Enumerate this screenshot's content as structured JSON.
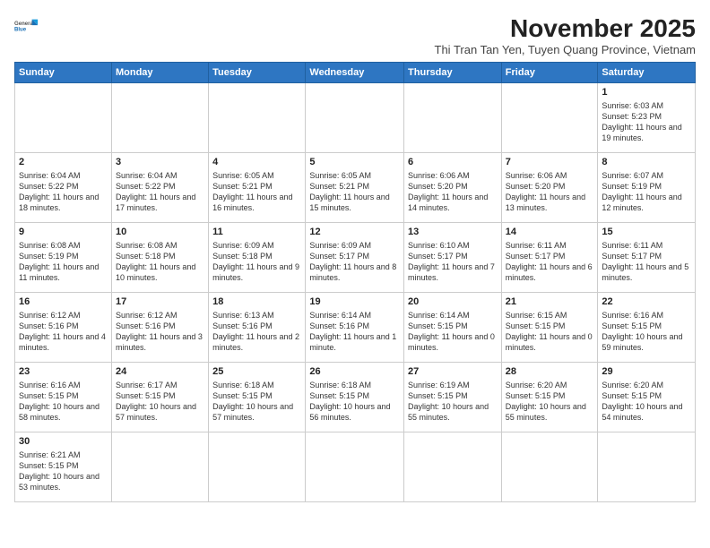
{
  "logo": {
    "line1": "General",
    "line2": "Blue"
  },
  "title": "November 2025",
  "subtitle": "Thi Tran Tan Yen, Tuyen Quang Province, Vietnam",
  "weekdays": [
    "Sunday",
    "Monday",
    "Tuesday",
    "Wednesday",
    "Thursday",
    "Friday",
    "Saturday"
  ],
  "weeks": [
    [
      {
        "day": "",
        "info": ""
      },
      {
        "day": "",
        "info": ""
      },
      {
        "day": "",
        "info": ""
      },
      {
        "day": "",
        "info": ""
      },
      {
        "day": "",
        "info": ""
      },
      {
        "day": "",
        "info": ""
      },
      {
        "day": "1",
        "info": "Sunrise: 6:03 AM\nSunset: 5:23 PM\nDaylight: 11 hours and 19 minutes."
      }
    ],
    [
      {
        "day": "2",
        "info": "Sunrise: 6:04 AM\nSunset: 5:22 PM\nDaylight: 11 hours and 18 minutes."
      },
      {
        "day": "3",
        "info": "Sunrise: 6:04 AM\nSunset: 5:22 PM\nDaylight: 11 hours and 17 minutes."
      },
      {
        "day": "4",
        "info": "Sunrise: 6:05 AM\nSunset: 5:21 PM\nDaylight: 11 hours and 16 minutes."
      },
      {
        "day": "5",
        "info": "Sunrise: 6:05 AM\nSunset: 5:21 PM\nDaylight: 11 hours and 15 minutes."
      },
      {
        "day": "6",
        "info": "Sunrise: 6:06 AM\nSunset: 5:20 PM\nDaylight: 11 hours and 14 minutes."
      },
      {
        "day": "7",
        "info": "Sunrise: 6:06 AM\nSunset: 5:20 PM\nDaylight: 11 hours and 13 minutes."
      },
      {
        "day": "8",
        "info": "Sunrise: 6:07 AM\nSunset: 5:19 PM\nDaylight: 11 hours and 12 minutes."
      }
    ],
    [
      {
        "day": "9",
        "info": "Sunrise: 6:08 AM\nSunset: 5:19 PM\nDaylight: 11 hours and 11 minutes."
      },
      {
        "day": "10",
        "info": "Sunrise: 6:08 AM\nSunset: 5:18 PM\nDaylight: 11 hours and 10 minutes."
      },
      {
        "day": "11",
        "info": "Sunrise: 6:09 AM\nSunset: 5:18 PM\nDaylight: 11 hours and 9 minutes."
      },
      {
        "day": "12",
        "info": "Sunrise: 6:09 AM\nSunset: 5:17 PM\nDaylight: 11 hours and 8 minutes."
      },
      {
        "day": "13",
        "info": "Sunrise: 6:10 AM\nSunset: 5:17 PM\nDaylight: 11 hours and 7 minutes."
      },
      {
        "day": "14",
        "info": "Sunrise: 6:11 AM\nSunset: 5:17 PM\nDaylight: 11 hours and 6 minutes."
      },
      {
        "day": "15",
        "info": "Sunrise: 6:11 AM\nSunset: 5:17 PM\nDaylight: 11 hours and 5 minutes."
      }
    ],
    [
      {
        "day": "16",
        "info": "Sunrise: 6:12 AM\nSunset: 5:16 PM\nDaylight: 11 hours and 4 minutes."
      },
      {
        "day": "17",
        "info": "Sunrise: 6:12 AM\nSunset: 5:16 PM\nDaylight: 11 hours and 3 minutes."
      },
      {
        "day": "18",
        "info": "Sunrise: 6:13 AM\nSunset: 5:16 PM\nDaylight: 11 hours and 2 minutes."
      },
      {
        "day": "19",
        "info": "Sunrise: 6:14 AM\nSunset: 5:16 PM\nDaylight: 11 hours and 1 minute."
      },
      {
        "day": "20",
        "info": "Sunrise: 6:14 AM\nSunset: 5:15 PM\nDaylight: 11 hours and 0 minutes."
      },
      {
        "day": "21",
        "info": "Sunrise: 6:15 AM\nSunset: 5:15 PM\nDaylight: 11 hours and 0 minutes."
      },
      {
        "day": "22",
        "info": "Sunrise: 6:16 AM\nSunset: 5:15 PM\nDaylight: 10 hours and 59 minutes."
      }
    ],
    [
      {
        "day": "23",
        "info": "Sunrise: 6:16 AM\nSunset: 5:15 PM\nDaylight: 10 hours and 58 minutes."
      },
      {
        "day": "24",
        "info": "Sunrise: 6:17 AM\nSunset: 5:15 PM\nDaylight: 10 hours and 57 minutes."
      },
      {
        "day": "25",
        "info": "Sunrise: 6:18 AM\nSunset: 5:15 PM\nDaylight: 10 hours and 57 minutes."
      },
      {
        "day": "26",
        "info": "Sunrise: 6:18 AM\nSunset: 5:15 PM\nDaylight: 10 hours and 56 minutes."
      },
      {
        "day": "27",
        "info": "Sunrise: 6:19 AM\nSunset: 5:15 PM\nDaylight: 10 hours and 55 minutes."
      },
      {
        "day": "28",
        "info": "Sunrise: 6:20 AM\nSunset: 5:15 PM\nDaylight: 10 hours and 55 minutes."
      },
      {
        "day": "29",
        "info": "Sunrise: 6:20 AM\nSunset: 5:15 PM\nDaylight: 10 hours and 54 minutes."
      }
    ],
    [
      {
        "day": "30",
        "info": "Sunrise: 6:21 AM\nSunset: 5:15 PM\nDaylight: 10 hours and 53 minutes."
      },
      {
        "day": "",
        "info": ""
      },
      {
        "day": "",
        "info": ""
      },
      {
        "day": "",
        "info": ""
      },
      {
        "day": "",
        "info": ""
      },
      {
        "day": "",
        "info": ""
      },
      {
        "day": "",
        "info": ""
      }
    ]
  ]
}
